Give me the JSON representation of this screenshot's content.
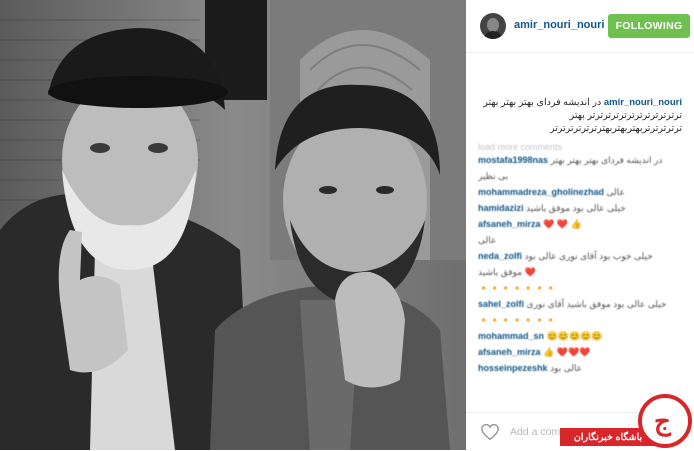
{
  "post": {
    "username": "amir_nouri_nouri",
    "follow_label": "FOLLOWING",
    "caption_user": "amir_nouri_nouri",
    "caption_text": "در اندیشه فردای بهتر بهتر بهتر ترترترترترترترترترترترتر بهتر ترترترترتربهتربهتربهترترترترترترتر",
    "load_more": "load more comments",
    "add_comment_placeholder": "Add a comment..."
  },
  "comments": [
    {
      "user": "mostafa1998nas",
      "text": "در اندیشه فردای بهتر بهتر بهتر"
    },
    {
      "user": "",
      "text": "بی نظیر"
    },
    {
      "user": "mohammadreza_gholinezhad",
      "text": "عالی"
    },
    {
      "user": "hamidazizi",
      "text": "خیلی عالی بود موفق باشید"
    },
    {
      "user": "",
      "text": ""
    },
    {
      "user": "afsaneh_mirza",
      "text": "❤️ ❤️ 👍"
    },
    {
      "user": "",
      "text": "عالی"
    },
    {
      "user": "neda_zolfi",
      "text": "خیلی خوب بود آقای نوری عالی بود"
    },
    {
      "user": "",
      "text": "موفق باشید ❤️"
    },
    {
      "user": "",
      "text": "🔸🔸🔸🔸🔸🔸🔸"
    },
    {
      "user": "sahel_zolfi",
      "text": "خیلی عالی بود موفق باشید آقای نوری"
    },
    {
      "user": "",
      "text": "🔸🔸🔸🔸🔸🔸🔸"
    },
    {
      "user": "mohammad_sn",
      "text": "😊😊😊😊😊"
    },
    {
      "user": "afsaneh_mirza",
      "text": "👍 ❤️❤️❤️"
    },
    {
      "user": "hosseinpezeshk",
      "text": "عالی بود"
    }
  ],
  "watermark": {
    "text": "باشگاه خبرنگاران",
    "logo_mark": "ج"
  },
  "colors": {
    "follow_bg": "#70c050",
    "username": "#125688",
    "watermark_red": "#d8262a"
  },
  "icons": {
    "heart": "heart-outline-icon",
    "avatar": "profile-avatar"
  }
}
